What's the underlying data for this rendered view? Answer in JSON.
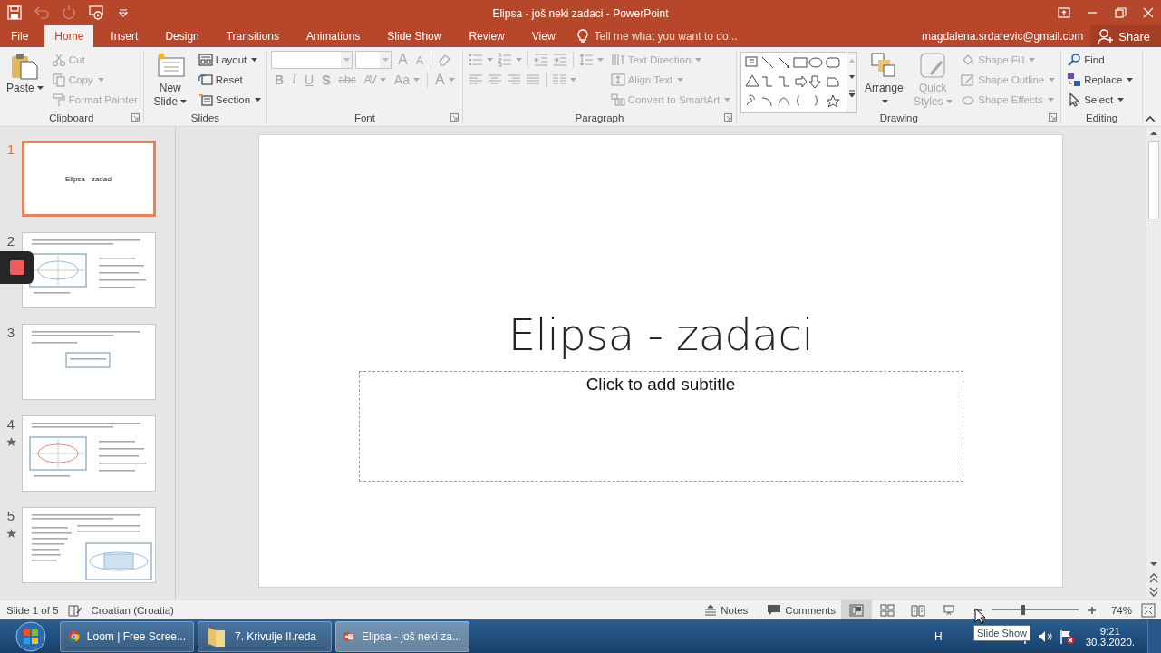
{
  "window": {
    "title": "Elipsa - još neki zadaci - PowerPoint"
  },
  "quick_access": [
    {
      "kind": "save",
      "disabled": false
    },
    {
      "kind": "undo",
      "disabled": true
    },
    {
      "kind": "redo",
      "disabled": true
    },
    {
      "kind": "present",
      "disabled": false
    },
    {
      "kind": "customize",
      "disabled": false
    }
  ],
  "window_controls": [
    {
      "kind": "ribbon_options"
    },
    {
      "kind": "minimize"
    },
    {
      "kind": "restore"
    },
    {
      "kind": "close"
    }
  ],
  "tabs": [
    {
      "label": "File",
      "selected": false
    },
    {
      "label": "Home",
      "selected": true
    },
    {
      "label": "Insert",
      "selected": false
    },
    {
      "label": "Design",
      "selected": false
    },
    {
      "label": "Transitions",
      "selected": false
    },
    {
      "label": "Animations",
      "selected": false
    },
    {
      "label": "Slide Show",
      "selected": false
    },
    {
      "label": "Review",
      "selected": false
    },
    {
      "label": "View",
      "selected": false
    }
  ],
  "tell_me": {
    "placeholder": "Tell me what you want to do..."
  },
  "account": {
    "email": "magdalena.srdarevic@gmail.com"
  },
  "share_button": {
    "label": "Share"
  },
  "ribbon": {
    "groups": [
      {
        "label": "Clipboard",
        "launcher": true,
        "columns": [
          [
            [
              {
                "kind": "large",
                "label": "Paste",
                "dropdown": true,
                "disabled": false
              }
            ]
          ],
          [
            [
              {
                "kind": "small",
                "label": "Cut",
                "dropdown": false,
                "disabled": true
              }
            ],
            [
              {
                "kind": "small",
                "label": "Copy",
                "dropdown": true,
                "disabled": true
              }
            ],
            [
              {
                "kind": "small",
                "label": "Format Painter",
                "dropdown": false,
                "disabled": true
              }
            ]
          ]
        ]
      },
      {
        "label": "Slides",
        "launcher": false,
        "columns": [
          [
            [
              {
                "kind": "large",
                "label": "New Slide",
                "dropdown": true,
                "disabled": false
              }
            ]
          ],
          [
            [
              {
                "kind": "small",
                "label": "Layout",
                "dropdown": true,
                "disabled": false
              }
            ],
            [
              {
                "kind": "small",
                "label": "Reset",
                "dropdown": false,
                "disabled": false
              }
            ],
            [
              {
                "kind": "small",
                "label": "Section",
                "dropdown": true,
                "disabled": false
              }
            ]
          ]
        ]
      },
      {
        "label": "Font",
        "launcher": true,
        "columns": [
          [
            [
              {
                "kind": "combo",
                "dropdown": true,
                "disabled": true
              },
              {
                "kind": "combo",
                "dropdown": true,
                "disabled": true
              },
              {
                "kind": "glyph",
                "label": "A",
                "dropdown": false,
                "disabled": true
              },
              {
                "kind": "glyph",
                "label": "A",
                "dropdown": false,
                "disabled": true
              },
              {
                "kind": "separator"
              },
              {
                "kind": "icon",
                "dropdown": false,
                "disabled": true
              }
            ],
            [
              {
                "kind": "glyph",
                "label": "B",
                "dropdown": false,
                "disabled": true
              },
              {
                "kind": "glyph",
                "label": "I",
                "dropdown": false,
                "disabled": true
              },
              {
                "kind": "glyph",
                "label": "U",
                "dropdown": false,
                "disabled": true
              },
              {
                "kind": "glyph",
                "label": "S",
                "dropdown": false,
                "disabled": true
              },
              {
                "kind": "glyph",
                "label": "abc",
                "dropdown": false,
                "disabled": true
              },
              {
                "kind": "glyph",
                "label": "AV",
                "dropdown": true,
                "disabled": true
              },
              {
                "kind": "glyph",
                "label": "Aa",
                "dropdown": true,
                "disabled": true
              },
              {
                "kind": "separator"
              },
              {
                "kind": "glyph",
                "label": "A",
                "dropdown": true,
                "disabled": true
              }
            ]
          ]
        ]
      },
      {
        "label": "Paragraph",
        "launcher": true,
        "columns": [
          [
            [
              {
                "kind": "icon",
                "dropdown": true,
                "disabled": true
              },
              {
                "kind": "icon",
                "dropdown": true,
                "disabled": true
              },
              {
                "kind": "separator"
              },
              {
                "kind": "icon",
                "dropdown": false,
                "disabled": true
              },
              {
                "kind": "icon",
                "dropdown": false,
                "disabled": true
              },
              {
                "kind": "separator"
              },
              {
                "kind": "icon",
                "dropdown": true,
                "disabled": true
              }
            ],
            [
              {
                "kind": "icon",
                "dropdown": false,
                "disabled": true
              },
              {
                "kind": "icon",
                "dropdown": false,
                "disabled": true
              },
              {
                "kind": "icon",
                "dropdown": false,
                "disabled": true
              },
              {
                "kind": "icon",
                "dropdown": false,
                "disabled": true
              },
              {
                "kind": "separator"
              },
              {
                "kind": "icon",
                "dropdown": true,
                "disabled": true
              }
            ]
          ],
          [
            [
              {
                "kind": "small",
                "label": "Text Direction",
                "dropdown": true,
                "disabled": true
              }
            ],
            [
              {
                "kind": "small",
                "label": "Align Text",
                "dropdown": true,
                "disabled": true
              }
            ],
            [
              {
                "kind": "small",
                "label": "Convert to SmartArt",
                "dropdown": true,
                "disabled": true
              }
            ]
          ]
        ]
      },
      {
        "label": "Drawing",
        "launcher": true,
        "columns": [
          [
            [
              {
                "kind": "gallery"
              }
            ]
          ],
          [
            [
              {
                "kind": "large",
                "label": "Arrange",
                "dropdown": true,
                "disabled": false
              }
            ]
          ],
          [
            [
              {
                "kind": "large",
                "label": "Quick Styles",
                "dropdown": true,
                "disabled": true
              }
            ]
          ],
          [
            [
              {
                "kind": "small",
                "label": "Shape Fill",
                "dropdown": true,
                "disabled": true
              }
            ],
            [
              {
                "kind": "small",
                "label": "Shape Outline",
                "dropdown": true,
                "disabled": true
              }
            ],
            [
              {
                "kind": "small",
                "label": "Shape Effects",
                "dropdown": true,
                "disabled": true
              }
            ]
          ]
        ]
      },
      {
        "label": "Editing",
        "launcher": false,
        "columns": [
          [
            [
              {
                "kind": "small",
                "label": "Find",
                "dropdown": false,
                "disabled": false
              }
            ],
            [
              {
                "kind": "small",
                "label": "Replace",
                "dropdown": true,
                "disabled": false
              }
            ],
            [
              {
                "kind": "small",
                "label": "Select",
                "dropdown": true,
                "disabled": false
              }
            ]
          ]
        ]
      }
    ]
  },
  "slides": [
    {
      "number": "1",
      "selected": true,
      "animated": false,
      "title": "Elipsa - zadaci"
    },
    {
      "number": "2",
      "selected": false,
      "animated": false,
      "kind": "picture"
    },
    {
      "number": "3",
      "selected": false,
      "animated": false,
      "kind": "picture"
    },
    {
      "number": "4",
      "selected": false,
      "animated": true,
      "kind": "picture"
    },
    {
      "number": "5",
      "selected": false,
      "animated": true,
      "kind": "picture"
    }
  ],
  "recording_control": {
    "recording": true
  },
  "slide": {
    "title": "Elipsa - zadaci",
    "subtitle_placeholder": "Click to add subtitle"
  },
  "status_bar": {
    "slide_counter": "Slide 1 of 5",
    "language": "Croatian (Croatia)",
    "notes": "Notes",
    "comments": "Comments",
    "views": [
      {
        "kind": "normal",
        "selected": true
      },
      {
        "kind": "sorter",
        "selected": false
      },
      {
        "kind": "reading",
        "selected": false
      },
      {
        "kind": "slideshow",
        "selected": false
      }
    ],
    "zoom": {
      "level": 0.37,
      "reading": "74%"
    }
  },
  "tooltip": {
    "text": "Slide Show"
  },
  "taskbar": {
    "tasks": [
      {
        "kind": "browser",
        "label": "Loom | Free Scree...",
        "selected": false
      },
      {
        "kind": "folder",
        "label": "7. Krivulje II.reda",
        "selected": false
      },
      {
        "kind": "presentation",
        "label": "Elipsa - još neki za...",
        "selected": true
      }
    ],
    "language": "H",
    "time": "9:21",
    "date": "30.3.2020."
  }
}
